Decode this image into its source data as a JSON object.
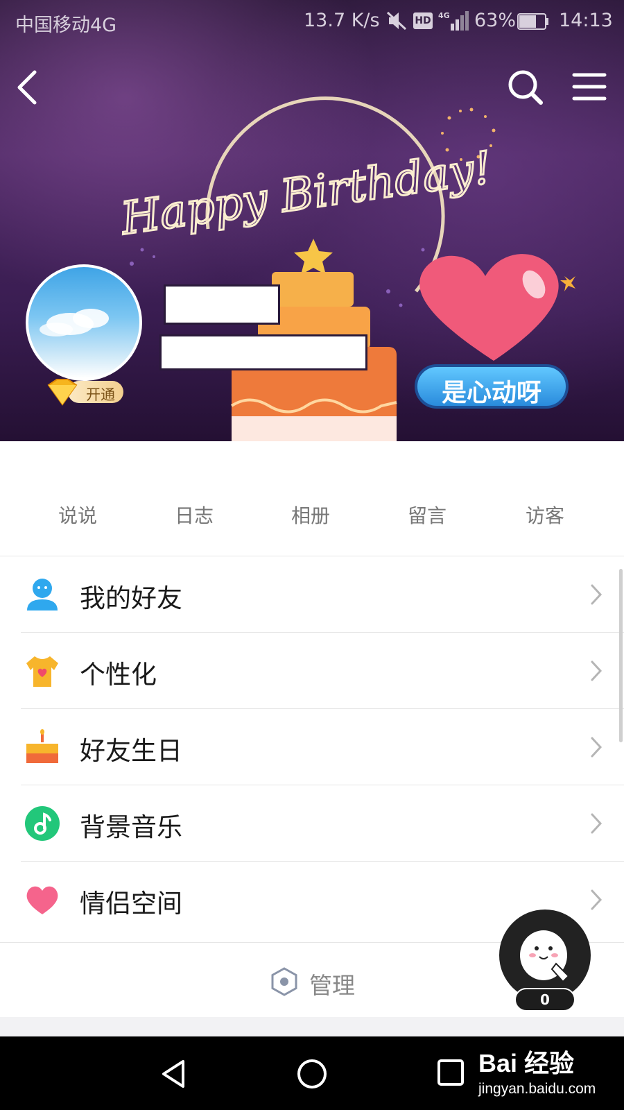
{
  "status_bar": {
    "carrier": "中国移动4G",
    "speed": "13.7 K/s",
    "hd": "HD",
    "network": "4G",
    "battery": "63%",
    "time": "14:13"
  },
  "hero": {
    "banner_text": "Happy Birthday!",
    "vip_label": "开通",
    "tag_label": "是心动呀"
  },
  "tabs": [
    "说说",
    "日志",
    "相册",
    "留言",
    "访客"
  ],
  "menu": [
    {
      "label": "我的好友",
      "icon": "friends-icon"
    },
    {
      "label": "个性化",
      "icon": "tshirt-icon"
    },
    {
      "label": "好友生日",
      "icon": "birthday-cake-icon"
    },
    {
      "label": "背景音乐",
      "icon": "music-note-icon"
    },
    {
      "label": "情侣空间",
      "icon": "heart-icon"
    }
  ],
  "manage": {
    "label": "管理"
  },
  "fab": {
    "count": "0"
  },
  "watermark": {
    "logo": "Bai 经验",
    "site": "jingyan.baidu.com"
  },
  "colors": {
    "hero_bg": "#3a1d52",
    "tag_blue": "#2a8bdc",
    "heart_pink": "#f05a7a",
    "music_green": "#22c77a"
  }
}
